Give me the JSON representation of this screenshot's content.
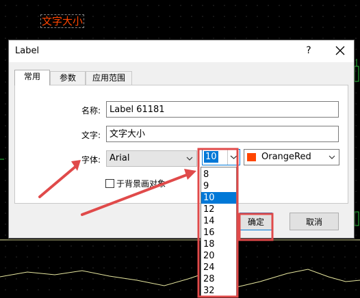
{
  "chart": {
    "label_text": "文字大小"
  },
  "dialog": {
    "title": "Label",
    "help_glyph": "?",
    "tabs": [
      "常用",
      "参数",
      "应用范围"
    ],
    "fields": {
      "name_label": "名称:",
      "name_value": "Label 61181",
      "text_label": "文字:",
      "text_value": "文字大小",
      "font_label": "字体:",
      "font_value": "Arial",
      "size_value": "10",
      "color_value": "OrangeRed",
      "background_checkbox_label": "于背景画对象"
    },
    "ok_label": "确定",
    "cancel_label": "取消"
  },
  "size_dropdown": {
    "options": [
      "8",
      "9",
      "10",
      "12",
      "14",
      "16",
      "18",
      "20",
      "24",
      "28",
      "32"
    ],
    "selected": "10"
  },
  "colors": {
    "label_color": "#ff4500",
    "annotation_red": "#e04a4a",
    "selection_blue": "#0078d7"
  }
}
